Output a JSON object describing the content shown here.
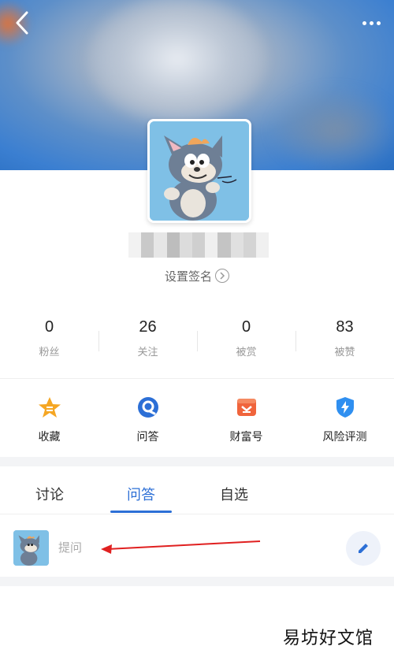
{
  "header": {
    "back_icon": "chevron-left-icon",
    "more_icon": "more-dots-icon"
  },
  "profile": {
    "avatar_icon": "cartoon-cat-avatar",
    "signature_label": "设置签名"
  },
  "stats": [
    {
      "value": "0",
      "label": "粉丝"
    },
    {
      "value": "26",
      "label": "关注"
    },
    {
      "value": "0",
      "label": "被赏"
    },
    {
      "value": "83",
      "label": "被赞"
    }
  ],
  "tools": [
    {
      "label": "收藏",
      "icon": "star-icon",
      "color": "#f5a623"
    },
    {
      "label": "问答",
      "icon": "qa-bubble-icon",
      "color": "#2c6fd6"
    },
    {
      "label": "财富号",
      "icon": "wealth-icon",
      "color": "#f0643c"
    },
    {
      "label": "风险评测",
      "icon": "shield-bolt-icon",
      "color": "#2f8ff0"
    }
  ],
  "tabs": [
    {
      "label": "讨论",
      "active": false
    },
    {
      "label": "问答",
      "active": true
    },
    {
      "label": "自选",
      "active": false
    }
  ],
  "ask": {
    "placeholder": "提问",
    "edit_icon": "pencil-icon"
  },
  "watermark": "易坊好文馆",
  "colors": {
    "accent": "#2c6fd6",
    "annotation_arrow": "#e02020"
  }
}
